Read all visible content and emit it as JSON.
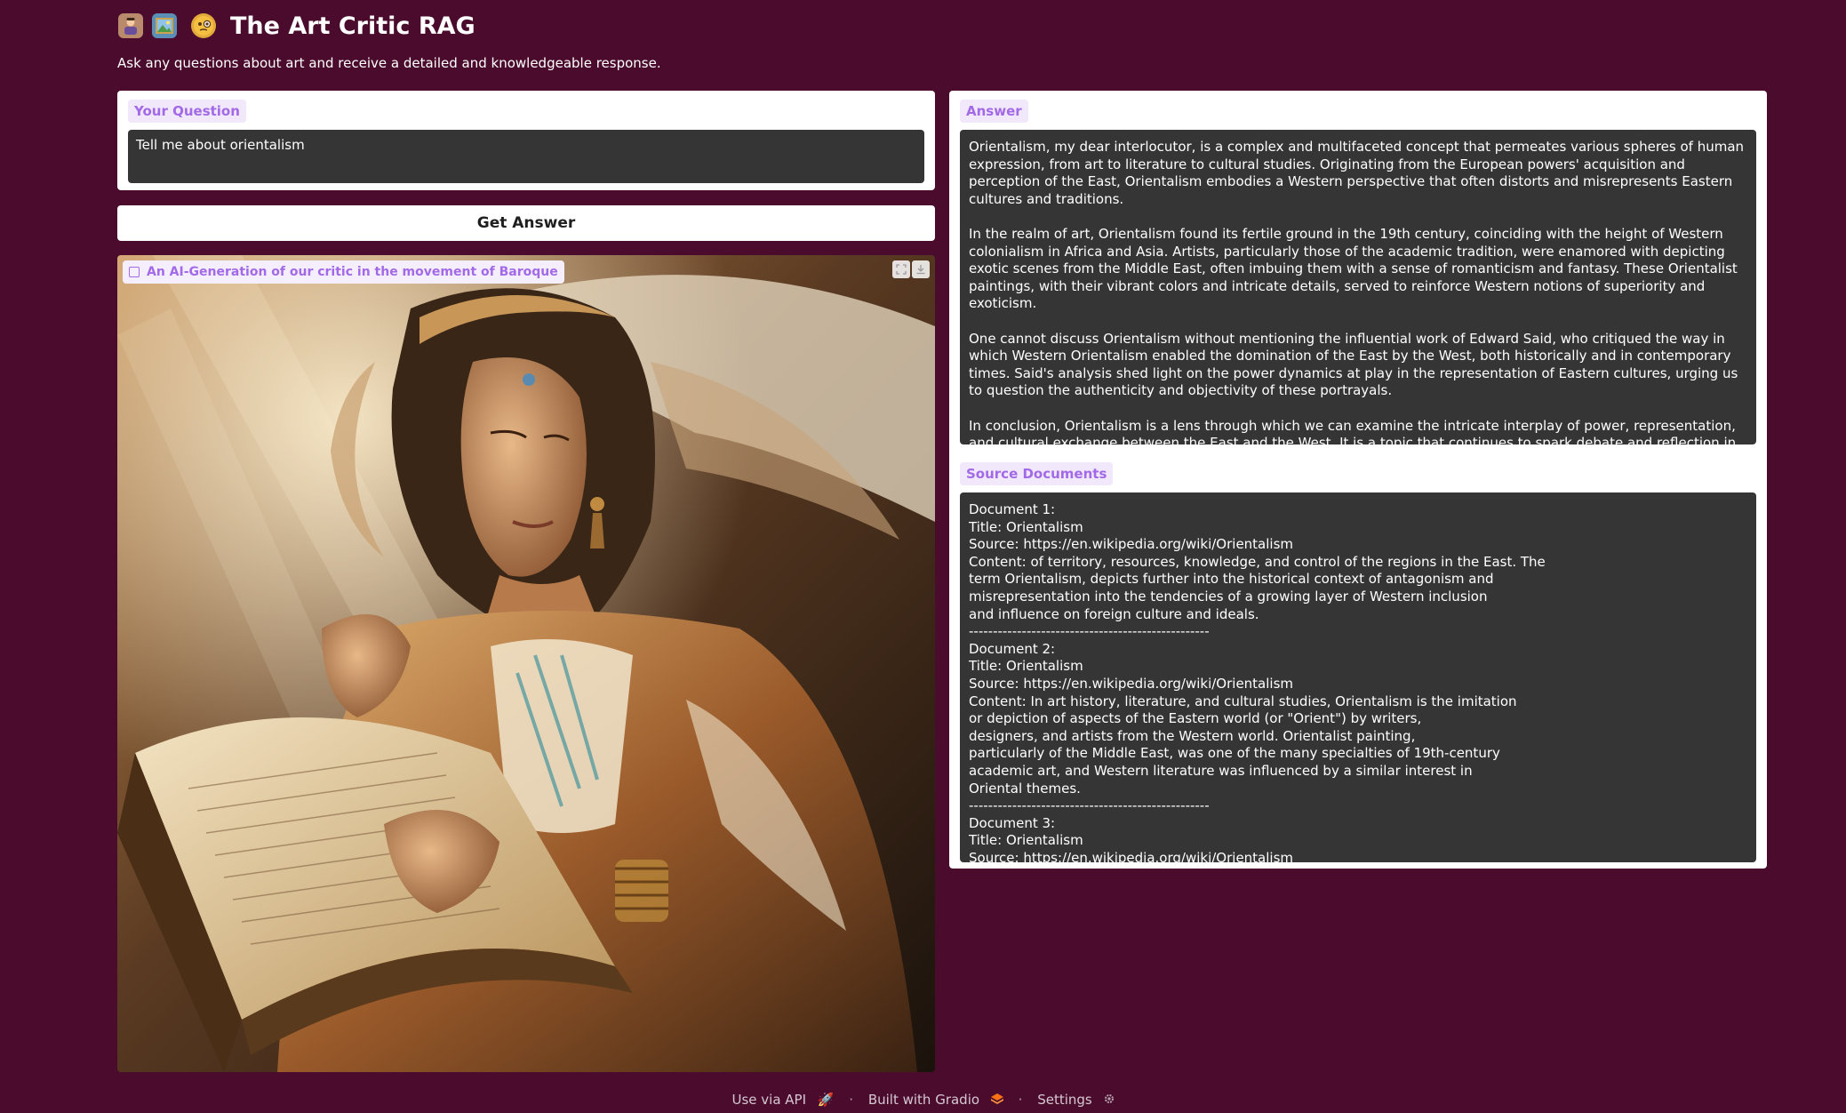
{
  "header": {
    "emojis": [
      "artist-emoji",
      "framed-picture-emoji",
      "monocle-face-emoji"
    ],
    "title": "The Art Critic RAG",
    "subtitle": "Ask any questions about art and receive a detailed and knowledgeable response."
  },
  "question": {
    "label": "Your Question",
    "value": "Tell me about orientalism"
  },
  "button": {
    "label": "Get Answer"
  },
  "image": {
    "label": "An AI-Generation of our critic in the movement of Baroque",
    "tools": [
      "fullscreen-icon",
      "download-icon"
    ]
  },
  "answer": {
    "label": "Answer",
    "paragraphs": [
      "Orientalism, my dear interlocutor, is a complex and multifaceted concept that permeates various spheres of human expression, from art to literature to cultural studies. Originating from the European powers' acquisition and perception of the East, Orientalism embodies a Western perspective that often distorts and misrepresents Eastern cultures and traditions.",
      "In the realm of art, Orientalism found its fertile ground in the 19th century, coinciding with the height of Western colonialism in Africa and Asia. Artists, particularly those of the academic tradition, were enamored with depicting exotic scenes from the Middle East, often imbuing them with a sense of romanticism and fantasy. These Orientalist paintings, with their vibrant colors and intricate details, served to reinforce Western notions of superiority and exoticism.",
      "One cannot discuss Orientalism without mentioning the influential work of Edward Said, who critiqued the way in which Western Orientalism enabled the domination of the East by the West, both historically and in contemporary times. Said's analysis shed light on the power dynamics at play in the representation of Eastern cultures, urging us to question the authenticity and objectivity of these portrayals.",
      "In conclusion, Orientalism is a lens through which we can examine the intricate interplay of power, representation, and cultural exchange between the East and the West. It is a topic that continues to spark debate and reflection in the realms of art history and beyond."
    ]
  },
  "sources": {
    "label": "Source Documents",
    "lines": [
      "Document 1:",
      "Title: Orientalism",
      "Source: https://en.wikipedia.org/wiki/Orientalism",
      "Content: of territory, resources, knowledge, and control of the regions in the East. The",
      "term Orientalism, depicts further into the historical context of antagonism and",
      "misrepresentation into the tendencies of a growing layer of Western inclusion",
      "and influence on foreign culture and ideals.",
      "--------------------------------------------------",
      "Document 2:",
      "Title: Orientalism",
      "Source: https://en.wikipedia.org/wiki/Orientalism",
      "Content: In art history, literature, and cultural studies, Orientalism is the imitation",
      "or depiction of aspects of the Eastern world (or \"Orient\") by writers,",
      "designers, and artists from the Western world. Orientalist painting,",
      "particularly of the Middle East, was one of the many specialties of 19th-century",
      "academic art, and Western literature was influenced by a similar interest in",
      "Oriental themes.",
      "--------------------------------------------------",
      "Document 3:",
      "Title: Orientalism",
      "Source: https://en.wikipedia.org/wiki/Orientalism"
    ]
  },
  "footer": {
    "api": "Use via API",
    "built": "Built with Gradio",
    "settings": "Settings",
    "separator": "·"
  }
}
